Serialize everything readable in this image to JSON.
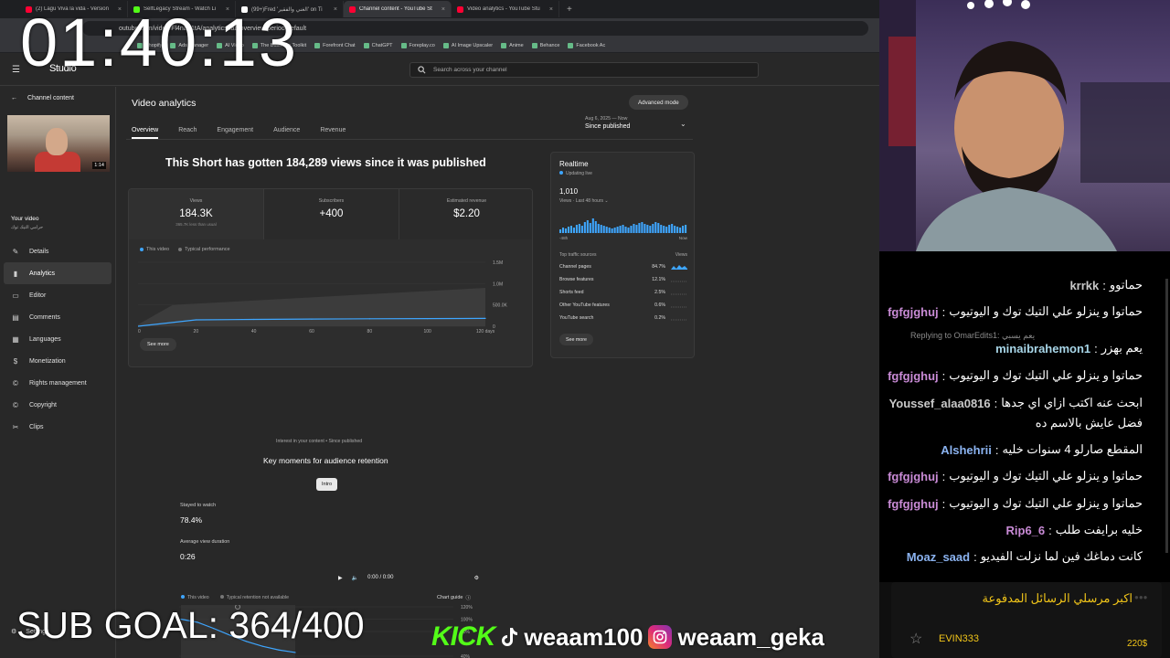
{
  "browser": {
    "tabs": [
      {
        "label": "(2) Lagu Viva la vida - Version",
        "color": "#ff0033",
        "active": false
      },
      {
        "label": "SelfLegacy Stream - Watch Li",
        "color": "#53fc18",
        "active": false
      },
      {
        "label": "(99+)Fred 'الغني والفقير' on Ti",
        "color": "#ffffff",
        "active": false
      },
      {
        "label": "Channel content - YouTube St",
        "color": "#ff0033",
        "active": true
      },
      {
        "label": "Video analytics - YouTube Stu",
        "color": "#ff0033",
        "active": false
      }
    ],
    "url": "outube.com/video/Fl4naZ1tA/analytics/tab-overview/period-default",
    "bookmarks": [
      "Shopify",
      "Ads Manager",
      "AI Video",
      "The Business Toolkit",
      "Forefront Chat",
      "ChatGPT",
      "Foreplay.co",
      "AI Image Upscaler",
      "Anime",
      "Behance",
      "Facebook Ac"
    ]
  },
  "studio": {
    "logo": "Studio",
    "search_placeholder": "Search across your channel",
    "sidebar": {
      "back_label": "Channel content",
      "thumb_duration": "1:14",
      "your_video": "Your video",
      "your_video_sub": "حرامي التيك توك",
      "items": [
        {
          "label": "Details",
          "icon": "✎",
          "active": false
        },
        {
          "label": "Analytics",
          "icon": "▮",
          "active": true
        },
        {
          "label": "Editor",
          "icon": "▭",
          "active": false
        },
        {
          "label": "Comments",
          "icon": "▤",
          "active": false
        },
        {
          "label": "Languages",
          "icon": "▦",
          "active": false
        },
        {
          "label": "Monetization",
          "icon": "$",
          "active": false
        },
        {
          "label": "Rights management",
          "icon": "©",
          "active": false
        },
        {
          "label": "Copyright",
          "icon": "©",
          "active": false
        },
        {
          "label": "Clips",
          "icon": "✂",
          "active": false
        }
      ],
      "settings": "Settings"
    },
    "main": {
      "title": "Video analytics",
      "advanced_mode": "Advanced mode",
      "tabs": [
        "Overview",
        "Reach",
        "Engagement",
        "Audience",
        "Revenue"
      ],
      "date_range_small": "Aug 6, 2025 — Now",
      "date_range": "Since published",
      "headline": "This Short has gotten 184,289 views since it was published",
      "metrics": [
        {
          "label": "Views",
          "value": "184.3K",
          "sub": "365.7K less than usual"
        },
        {
          "label": "Subscribers",
          "value": "+400",
          "sub": ""
        },
        {
          "label": "Estimated revenue",
          "value": "$2.20",
          "sub": ""
        }
      ],
      "legend": [
        "This video",
        "Typical performance"
      ],
      "see_more": "See more",
      "realtime": {
        "title": "Realtime",
        "status": "Updating live",
        "count": "1,010",
        "views_label": "Views · Last 48 hours",
        "axis_left": "-48h",
        "axis_right": "Now",
        "sources_header": "Top traffic sources",
        "views_header": "Views",
        "sources": [
          {
            "name": "Channel pages",
            "pct": "84.7%"
          },
          {
            "name": "Browse features",
            "pct": "12.1%"
          },
          {
            "name": "Shorts feed",
            "pct": "2.5%"
          },
          {
            "name": "Other YouTube features",
            "pct": "0.6%"
          },
          {
            "name": "YouTube search",
            "pct": "0.2%"
          }
        ],
        "see_more": "See more"
      },
      "interest_label": "Interest in your content • Since published",
      "key_moments": "Key moments for audience retention",
      "intro": "Intro",
      "stayed_label": "Stayed to watch",
      "stayed_value": "78.4%",
      "avd_label": "Average view duration",
      "avd_value": "0:26",
      "player_time": "0:00 / 0:00",
      "retention_legend": [
        "This video",
        "Typical retention not available"
      ],
      "chart_guide": "Chart guide"
    }
  },
  "chart_data": [
    {
      "type": "area",
      "title": "",
      "x": [
        0,
        20,
        40,
        60,
        80,
        100,
        120
      ],
      "x_tick_labels": [
        "0",
        "20",
        "40",
        "60",
        "80",
        "100",
        "120 days"
      ],
      "series": [
        {
          "name": "This video",
          "values": [
            0,
            150000,
            160000,
            168000,
            175000,
            180000,
            184289
          ]
        }
      ],
      "y_tick_labels": [
        "0",
        "500.0K",
        "1.0M",
        "1.5M"
      ],
      "ylim": [
        0,
        1500000
      ],
      "grid": true,
      "legend": "top-left"
    },
    {
      "type": "line",
      "title": "",
      "x": [
        0,
        2,
        4,
        6,
        8,
        10,
        12,
        14
      ],
      "series": [
        {
          "name": "This video",
          "values": [
            100,
            95,
            85,
            74,
            64,
            56,
            50,
            46
          ]
        }
      ],
      "y_tick_labels": [
        "120%",
        "100%",
        "80%",
        "40%"
      ],
      "ylim": [
        40,
        120
      ],
      "grid": true,
      "legend": "top-left"
    }
  ],
  "overlay": {
    "timer": "01:40:13",
    "sub_goal": "SUB GOAL: 364/400",
    "kick": "KICK",
    "tiktok_handle": "weaam100",
    "instagram_handle": "weaam_geka"
  },
  "chat": {
    "reply_note": "Replying to OmarEdits1: يعم يسبي",
    "messages": [
      {
        "user": "krrkk",
        "color": "#c9c9c9",
        "text": "حماتوو"
      },
      {
        "user": "fgfgjghuj",
        "color": "#c98bd6",
        "text": "حماتوا و ينزلو علي التيك توك و اليوتيوب"
      },
      {
        "user": "minaibrahemon1",
        "color": "#a8d6e8",
        "text": "يعم بهزر"
      },
      {
        "user": "fgfgjghuj",
        "color": "#c98bd6",
        "text": "حماتوا و ينزلو علي التيك توك و اليوتيوب"
      },
      {
        "user": "Youssef_alaa0816",
        "color": "#c9c9c9",
        "text": "ابحث عنه اكتب ازاي اي جدها"
      },
      {
        "user": "",
        "color": "#ffffff",
        "text": "فضل عايش بالاسم ده"
      },
      {
        "user": "Alshehrii",
        "color": "#8bb3f0",
        "text": "المقطع صارلو 4 سنوات خليه"
      },
      {
        "user": "fgfgjghuj",
        "color": "#c98bd6",
        "text": "حماتوا و ينزلو علي التيك توك و اليوتيوب"
      },
      {
        "user": "fgfgjghuj",
        "color": "#c98bd6",
        "text": "حماتوا و ينزلو علي التيك توك و اليوتيوب"
      },
      {
        "user": "Rip6_6",
        "color": "#c98bd6",
        "text": "خليه برايفت طلب"
      },
      {
        "user": "Moaz_saad",
        "color": "#8bb3f0",
        "text": "كانت دماغك فين لما نزلت الفيديو"
      }
    ],
    "donations_title": "اكبر مرسلي الرسائل المدفوعة",
    "top_donor": "EVIN333",
    "top_amount": "220$"
  }
}
